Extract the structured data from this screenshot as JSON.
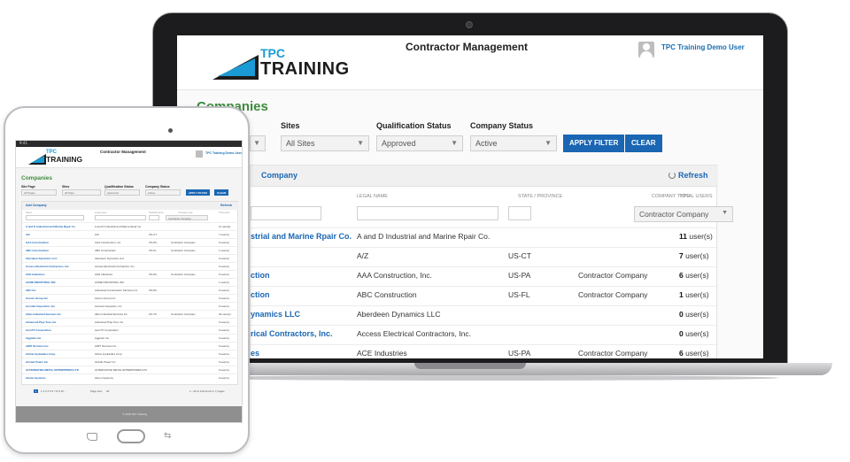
{
  "app": {
    "logo_tpc": "TPC",
    "logo_training": "TRAINING",
    "title": "Contractor Management",
    "user": "TPC Training Demo User"
  },
  "page": {
    "title": "Companies"
  },
  "filters": {
    "sites_label": "Sites",
    "sites_value": "All Sites",
    "qual_label": "Qualification Status",
    "qual_value": "Approved",
    "status_label": "Company Status",
    "status_value": "Active",
    "apply_label": "APPLY FILTER",
    "clear_label": "CLEAR"
  },
  "panel": {
    "title": "Company",
    "refresh_label": "Refresh"
  },
  "table": {
    "columns": {
      "legal": "LEGAL NAME",
      "state": "STATE / PROVINCE",
      "type": "COMPANY TYPE",
      "users": "TOTAL USERS"
    },
    "type_filter": "Contractor Company",
    "rows": [
      {
        "name": "strial and Marine Rpair Co.",
        "legal": "A and D Industrial and Marine Rpair Co.",
        "state": "",
        "type": "",
        "count": "11",
        "unit": "user(s)"
      },
      {
        "name": "",
        "legal": "A/Z",
        "state": "US-CT",
        "type": "",
        "count": "7",
        "unit": "user(s)"
      },
      {
        "name": "ction",
        "legal": "AAA Construction, Inc.",
        "state": "US-PA",
        "type": "Contractor Company",
        "count": "6",
        "unit": "user(s)"
      },
      {
        "name": "ction",
        "legal": "ABC Construction",
        "state": "US-FL",
        "type": "Contractor Company",
        "count": "1",
        "unit": "user(s)"
      },
      {
        "name": "ynamics LLC",
        "legal": "Aberdeen Dynamics LLC",
        "state": "",
        "type": "",
        "count": "0",
        "unit": "user(s)"
      },
      {
        "name": "rical Contractors, Inc.",
        "legal": "Access Electrical Contractors, Inc.",
        "state": "",
        "type": "",
        "count": "0",
        "unit": "user(s)"
      },
      {
        "name": "es",
        "legal": "ACE Industries",
        "state": "US-PA",
        "type": "Contractor Company",
        "count": "6",
        "unit": "user(s)"
      }
    ]
  },
  "tablet": {
    "status_bar": "9:41",
    "sitepage_label": "Site Page",
    "sitepage_value": "All Pages",
    "panel_title": "Add Company",
    "columns": [
      "Name",
      "Legal name",
      "State/Province",
      "Company type",
      "Total users"
    ],
    "rows": [
      {
        "name": "A and D Industrial and Marine Rpair Co.",
        "legal": "A and D Industrial and Marine Rpair Co.",
        "state": "",
        "type": "",
        "users": "11 user(s)"
      },
      {
        "name": "A/Z",
        "legal": "A/Z",
        "state": "US-CT",
        "type": "",
        "users": "7 user(s)"
      },
      {
        "name": "AAA Construction",
        "legal": "AAA Construction, Inc.",
        "state": "US-PA",
        "type": "Contractor Company",
        "users": "6 user(s)"
      },
      {
        "name": "ABC Construction",
        "legal": "ABC Construction",
        "state": "US-FL",
        "type": "Contractor Company",
        "users": "1 user(s)"
      },
      {
        "name": "Aberdeen Dynamics LLC",
        "legal": "Aberdeen Dynamics LLC",
        "state": "",
        "type": "",
        "users": "0 user(s)"
      },
      {
        "name": "Access Electrical Contractors, Inc.",
        "legal": "Access Electrical Contractors, Inc.",
        "state": "",
        "type": "",
        "users": "0 user(s)"
      },
      {
        "name": "ACE Industries",
        "legal": "ACE Industries",
        "state": "US-PA",
        "type": "Contractor Company",
        "users": "6 user(s)"
      },
      {
        "name": "ACME INDUSTRIAL INC",
        "legal": "ACME INDUSTRIAL INC",
        "state": "",
        "type": "",
        "users": "1 user(s)"
      },
      {
        "name": "ADC Inc",
        "legal": "Advanced Construction Services Inc",
        "state": "US-PA",
        "type": "",
        "users": "0 user(s)"
      },
      {
        "name": "Aecom Group Inc",
        "legal": "Aecom Group Inc",
        "state": "",
        "type": "",
        "users": "0 user(s)"
      },
      {
        "name": "Aerotek Inspection, Inc",
        "legal": "Aerotek Inspection, Inc",
        "state": "",
        "type": "",
        "users": "0 user(s)"
      },
      {
        "name": "Allen Industrial Services Inc",
        "legal": "Allen Industrial Services Inc",
        "state": "US-TX",
        "type": "Contractor Company",
        "users": "44 user(s)"
      },
      {
        "name": "Advanced Pipe Tool, Inc",
        "legal": "Advanced Pipe Tool, Inc",
        "state": "",
        "type": "",
        "users": "0 user(s)"
      },
      {
        "name": "AeroTX Corporation",
        "legal": "AeroTX Corporation",
        "state": "",
        "type": "",
        "users": "0 user(s)"
      },
      {
        "name": "Aggreko Inc",
        "legal": "Aggreko Inc",
        "state": "",
        "type": "",
        "users": "0 user(s)"
      },
      {
        "name": "AIMT Services Inc",
        "legal": "AIMT Services Inc",
        "state": "",
        "type": "",
        "users": "0 user(s)"
      },
      {
        "name": "Airline Hydraulics Corp",
        "legal": "Airline Hydraulics Corp",
        "state": "",
        "type": "",
        "users": "0 user(s)"
      },
      {
        "name": "Airside Power Inc",
        "legal": "Airside Power Inc",
        "state": "",
        "type": "",
        "users": "0 user(s)"
      },
      {
        "name": "ALTERNATIVE METAL ENTERPRISES LTD",
        "legal": "ALTERNATIVE METAL ENTERPRISES LTD",
        "state": "",
        "type": "",
        "users": "0 user(s)"
      },
      {
        "name": "Alumo Systems",
        "legal": "Alumo Systems",
        "state": "",
        "type": "",
        "users": "0 user(s)"
      }
    ],
    "pager_pages": "1 2 3 4 5 6 7 8 9 10 ...",
    "pager_current": "1",
    "pager_label": "Page size:",
    "pager_size": "20",
    "pager_info": "1 - 20 of 140 items in 7 pages",
    "footer": "© 2018 TPC Training"
  },
  "icons": {
    "refresh": "refresh-icon",
    "avatar": "user-avatar-icon",
    "caret": "chevron-down-icon"
  },
  "colors": {
    "brand_blue": "#1a66b3",
    "logo_blue": "#1a9bd6",
    "title_green": "#3d8b3d"
  }
}
